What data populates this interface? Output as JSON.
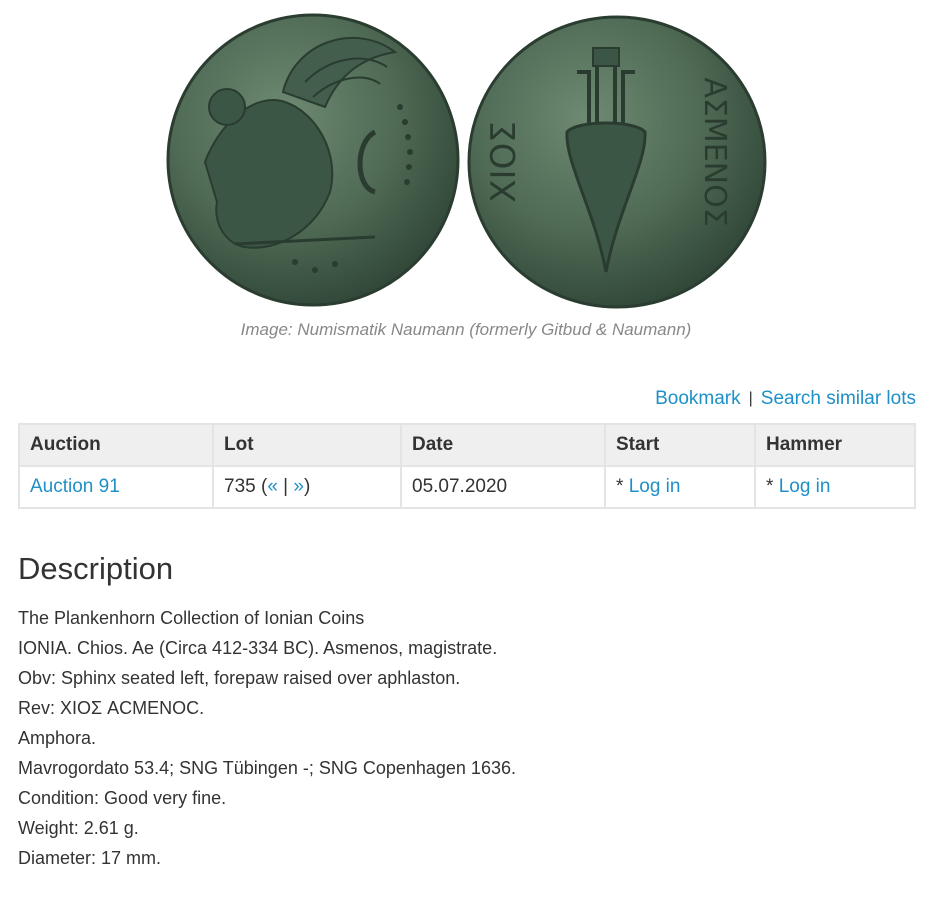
{
  "image": {
    "obverse_description": "Sphinx seated left, forepaw raised over aphlaston",
    "reverse_description": "Amphora with inscription",
    "reverse_legend_left": "ΧΙΟΣ",
    "reverse_legend_right": "ΑΣΜΕΝΟΣ",
    "coin_color": "#4f6a55"
  },
  "caption": "Image: Numismatik Naumann (formerly Gitbud & Naumann)",
  "actions": {
    "bookmark": "Bookmark",
    "separator": "|",
    "search_similar": "Search similar lots"
  },
  "table": {
    "headers": [
      "Auction",
      "Lot",
      "Date",
      "Start",
      "Hammer"
    ],
    "row": {
      "auction": "Auction 91",
      "lot_number": "735",
      "lot_open": "(",
      "prev": "«",
      "lot_sep": " | ",
      "next": "»",
      "lot_close": ")",
      "date": "05.07.2020",
      "start_prefix": "* ",
      "start_link": "Log in",
      "hammer_prefix": "* ",
      "hammer_link": "Log in"
    }
  },
  "description": {
    "title": "Description",
    "lines": [
      "The Plankenhorn Collection of Ionian Coins",
      "IONIA. Chios. Ae (Circa 412-334 BC). Asmenos, magistrate.",
      "Obv: Sphinx seated left, forepaw raised over aphlaston.",
      "Rev: ΧΙΟΣ ACMENOC.",
      "Amphora.",
      "Mavrogordato 53.4; SNG Tübingen -; SNG Copenhagen 1636.",
      "Condition: Good very fine.",
      "Weight: 2.61 g.",
      "Diameter: 17 mm."
    ]
  }
}
